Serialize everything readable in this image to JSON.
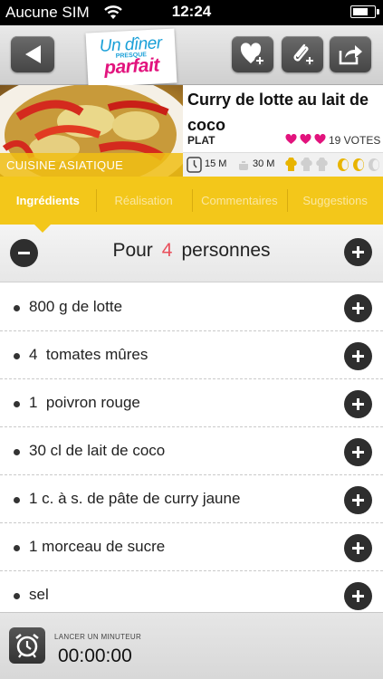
{
  "status_bar": {
    "carrier": "Aucune SIM",
    "time": "12:24",
    "battery_level": 0.75
  },
  "nav": {
    "logo": {
      "line1": "Un dîner",
      "line2": "PRESQUE",
      "line3": "parfait"
    },
    "icons": [
      "back-arrow-icon",
      "heart-plus-icon",
      "paperclip-plus-icon",
      "share-icon"
    ]
  },
  "recipe": {
    "title": "Curry de lotte au lait de coco",
    "type": "PLAT",
    "votes": "19 VOTES",
    "hearts": 3,
    "category": "CUISINE ASIATIQUE",
    "prep_time": "15 M",
    "cook_time": "30 M",
    "difficulty_filled": 1,
    "difficulty_total": 3,
    "cost_filled": 2,
    "cost_total": 3
  },
  "tabs": [
    {
      "label": "Ingrédients",
      "active": true
    },
    {
      "label": "Réalisation",
      "active": false
    },
    {
      "label": "Commentaires",
      "active": false
    },
    {
      "label": "Suggestions",
      "active": false
    }
  ],
  "servings": {
    "prefix": "Pour",
    "count": "4",
    "suffix": "personnes"
  },
  "ingredients": [
    "800 g de lotte",
    "4  tomates mûres",
    "1  poivron rouge",
    "30 cl de lait de coco",
    "1 c. à s. de pâte de curry jaune",
    "1 morceau de sucre",
    "sel"
  ],
  "timer": {
    "label": "LANCER UN MINUTEUR",
    "value": "00:00:00"
  },
  "colors": {
    "accent_yellow": "#f3c71a",
    "heart_pink": "#e2137d",
    "serving_red": "#e9505c"
  }
}
